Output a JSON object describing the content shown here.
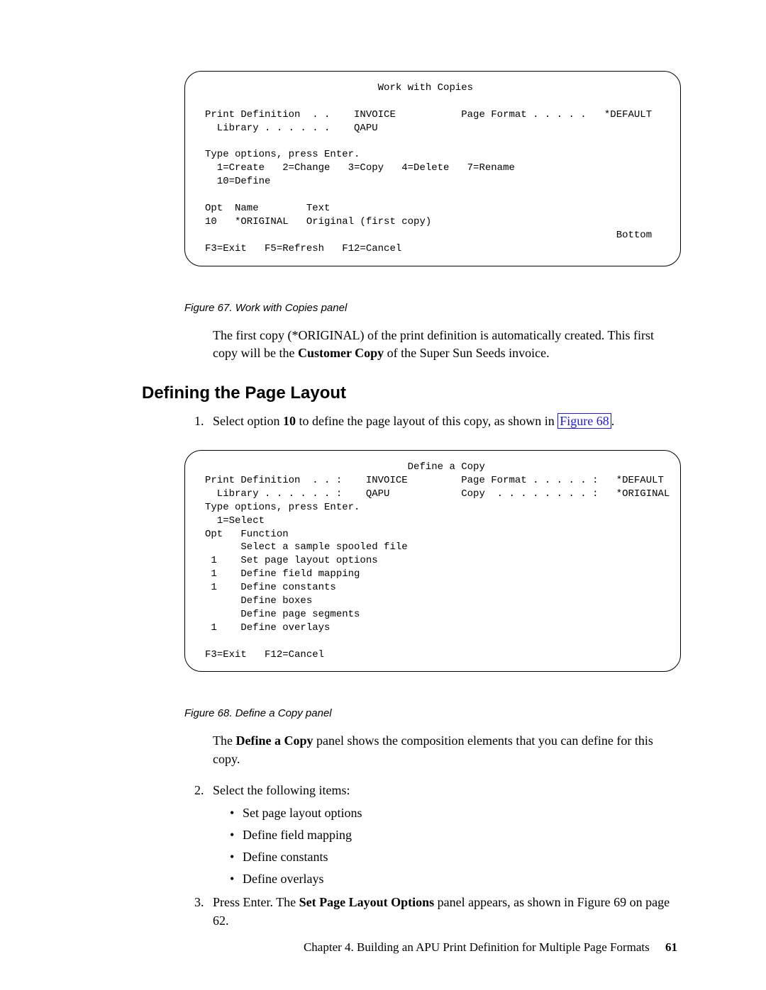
{
  "terminal1": {
    "content": "                             Work with Copies\n\nPrint Definition  . .    INVOICE           Page Format . . . . .   *DEFAULT\n  Library . . . . . .    QAPU\n\nType options, press Enter.\n  1=Create   2=Change   3=Copy   4=Delete   7=Rename\n  10=Define\n\nOpt  Name        Text\n10   *ORIGINAL   Original (first copy)\n                                                                     Bottom\nF3=Exit   F5=Refresh   F12=Cancel"
  },
  "caption1": "Figure 67. Work with Copies panel",
  "para1_a": "The first copy (*ORIGINAL) of the print definition is automatically created. This first copy will be the ",
  "para1_bold": "Customer Copy",
  "para1_b": " of the Super Sun Seeds invoice.",
  "heading": "Defining the Page Layout",
  "step1_num": "1.",
  "step1_a": "Select option ",
  "step1_bold": "10",
  "step1_b": " to define the page layout of this copy, as shown in ",
  "step1_link": "Figure 68",
  "step1_c": ".",
  "terminal2": {
    "content": "                                  Define a Copy\nPrint Definition  . . :    INVOICE         Page Format . . . . . :   *DEFAULT\n  Library . . . . . . :    QAPU            Copy  . . . . . . . . :   *ORIGINAL\nType options, press Enter.\n  1=Select\nOpt   Function\n      Select a sample spooled file\n 1    Set page layout options\n 1    Define field mapping\n 1    Define constants\n      Define boxes\n      Define page segments\n 1    Define overlays\n\nF3=Exit   F12=Cancel"
  },
  "caption2": "Figure 68. Define a Copy panel",
  "para2_a": "The ",
  "para2_bold": "Define a Copy",
  "para2_b": " panel shows the composition elements that you can define for this copy.",
  "step2_num": "2.",
  "step2_text": "Select the following items:",
  "bullets": {
    "b1": "Set page layout options",
    "b2": "Define field mapping",
    "b3": "Define constants",
    "b4": "Define overlays"
  },
  "step3_num": "3.",
  "step3_a": "Press Enter. The ",
  "step3_bold": "Set Page Layout Options",
  "step3_b": " panel appears, as shown in Figure 69 on page 62.",
  "footer_text": "Chapter 4. Building an APU Print Definition for Multiple Page Formats",
  "page_number": "61"
}
